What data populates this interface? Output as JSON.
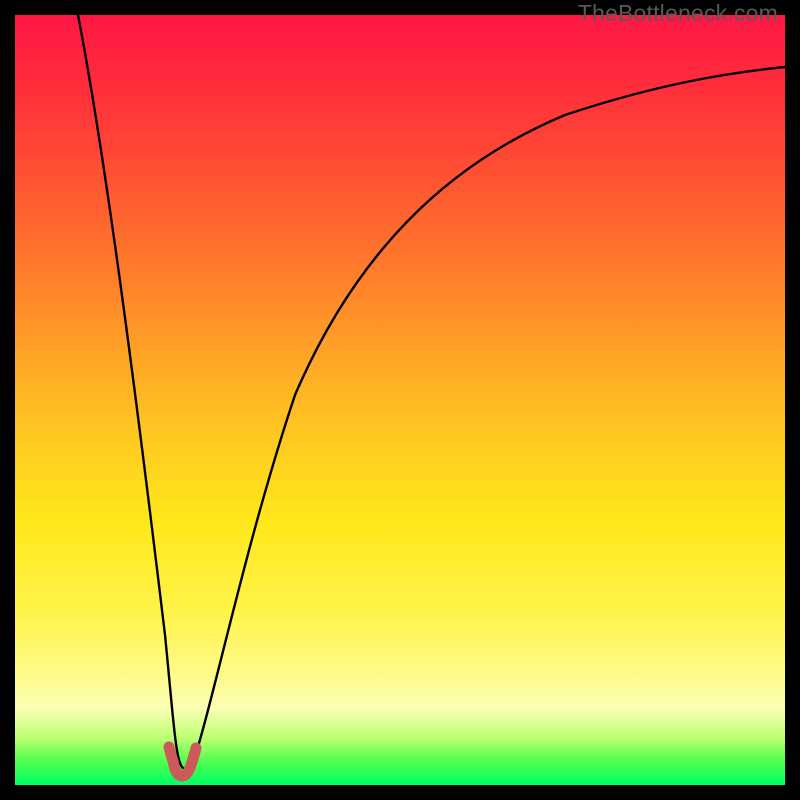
{
  "watermark": {
    "text": "TheBottleneck.com"
  },
  "chart_data": {
    "type": "line",
    "title": "",
    "xlabel": "",
    "ylabel": "",
    "xlim": [
      0,
      100
    ],
    "ylim": [
      0,
      100
    ],
    "series": [
      {
        "name": "bottleneck-curve",
        "x": [
          5,
          7,
          9,
          11,
          13,
          15,
          17,
          19,
          20,
          21,
          22,
          23,
          24,
          26,
          28,
          32,
          38,
          46,
          56,
          68,
          82,
          100
        ],
        "values": [
          100,
          88,
          76,
          64,
          52,
          40,
          28,
          16,
          6,
          1,
          0.5,
          1,
          6,
          20,
          35,
          55,
          70,
          80,
          86,
          90,
          93,
          95
        ]
      },
      {
        "name": "minimum-marker",
        "x": [
          20.5,
          21,
          22.4,
          22.8,
          23.3
        ],
        "values": [
          3.2,
          1.5,
          1.2,
          1.8,
          3.5
        ]
      }
    ],
    "gradient_stops": [
      {
        "pct": 0,
        "color": "#ff1744"
      },
      {
        "pct": 18,
        "color": "#ff4834"
      },
      {
        "pct": 38,
        "color": "#ff8d29"
      },
      {
        "pct": 58,
        "color": "#ffd21f"
      },
      {
        "pct": 86,
        "color": "#fffb8c"
      },
      {
        "pct": 94,
        "color": "#b9ff70"
      },
      {
        "pct": 100,
        "color": "#00ff66"
      }
    ]
  }
}
